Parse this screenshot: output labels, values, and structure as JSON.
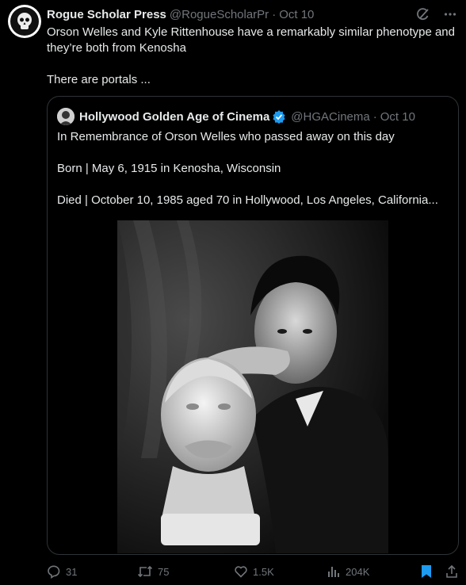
{
  "tweet": {
    "author_name": "Rogue Scholar Press",
    "author_handle": "@RogueScholarPr",
    "separator": "·",
    "date": "Oct 10",
    "text_line1": "Orson Welles and Kyle Rittenhouse have a remarkably similar phenotype and they’re both from Kenosha",
    "text_line2": "There are portals ...",
    "header_icons": [
      "grok-icon",
      "more-icon"
    ]
  },
  "quote": {
    "author_name": "Hollywood Golden Age of Cinema",
    "author_handle": "@HGACinema",
    "separator": "·",
    "date": "Oct 10",
    "line1": "In Remembrance of Orson Welles who passed away on this day",
    "line2": "Born | May 6, 1915 in Kenosha, Wisconsin",
    "line3": "Died | October 10, 1985 aged 70 in Hollywood, Los Angeles, California...",
    "verified": true
  },
  "actions": {
    "replies": "31",
    "retweets": "75",
    "likes": "1.5K",
    "views": "204K"
  },
  "colors": {
    "background": "#000000",
    "text": "#e7e9ea",
    "muted": "#71767b",
    "border": "#2f3336",
    "verified": "#1d9bf0",
    "bookmark": "#1d9bf0"
  }
}
